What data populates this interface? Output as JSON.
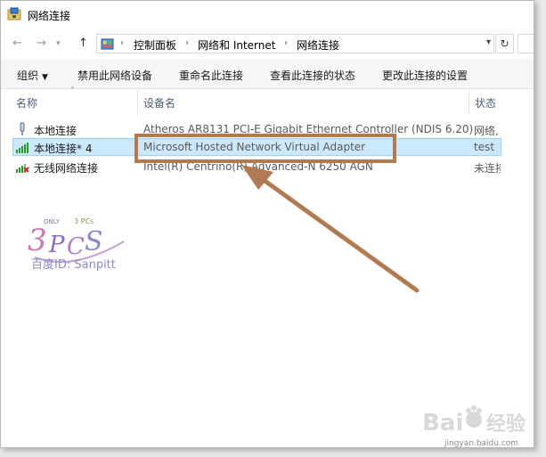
{
  "window": {
    "title": "网络连接"
  },
  "address": {
    "crumbs": [
      "控制面板",
      "网络和 Internet",
      "网络连接"
    ]
  },
  "toolbar": {
    "organize": "组织",
    "disable": "禁用此网络设备",
    "rename": "重命名此连接",
    "status": "查看此连接的状态",
    "settings": "更改此连接的设置"
  },
  "columns": {
    "name": "名称",
    "device": "设备名",
    "status": "状态"
  },
  "rows": [
    {
      "name": "本地连接",
      "device": "Atheros AR8131 PCI-E Gigabit Ethernet Controller (NDIS 6.20)",
      "status": "网络,"
    },
    {
      "name": "本地连接* 4",
      "device": "Microsoft Hosted Network Virtual Adapter",
      "status": "test"
    },
    {
      "name": "无线网络连接",
      "device": "Intel(R) Centrino(R) Advanced-N 6250 AGN",
      "status": "未连接"
    }
  ],
  "watermark": {
    "caption": "百度ID: Sanpitt"
  },
  "baidu": {
    "logo_text": "Bai 经验",
    "site": "jingyan.baidu.com"
  },
  "colors": {
    "highlight_box": "#b07a52",
    "arrow": "#b07a52",
    "selection": "#cce8ff"
  },
  "icons": [
    "network-folder-icon",
    "back-arrow-icon",
    "forward-arrow-icon",
    "up-arrow-icon",
    "refresh-icon",
    "ethernet-icon",
    "signal-bars-icon",
    "wireless-icon"
  ]
}
